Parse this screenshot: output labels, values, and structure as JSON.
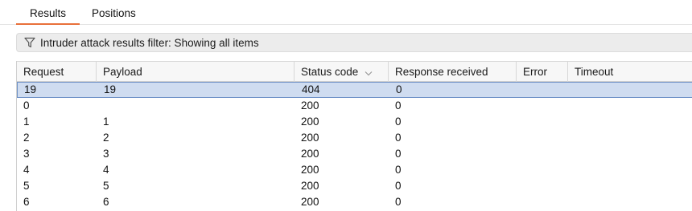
{
  "tabs": {
    "results": "Results",
    "positions": "Positions"
  },
  "filter": {
    "text": "Intruder attack results filter: Showing all items",
    "icon": "funnel-icon"
  },
  "table": {
    "columns": {
      "request": "Request",
      "payload": "Payload",
      "status": "Status code",
      "response": "Response received",
      "error": "Error",
      "timeout": "Timeout"
    },
    "sort_column": "status",
    "sort_direction": "descending",
    "selected_row": 0,
    "selection_color": "#cfdcf0",
    "rows": [
      {
        "request": "19",
        "payload": "19",
        "status": "404",
        "response": "0",
        "error": "",
        "timeout": ""
      },
      {
        "request": "0",
        "payload": "",
        "status": "200",
        "response": "0",
        "error": "",
        "timeout": ""
      },
      {
        "request": "1",
        "payload": "1",
        "status": "200",
        "response": "0",
        "error": "",
        "timeout": ""
      },
      {
        "request": "2",
        "payload": "2",
        "status": "200",
        "response": "0",
        "error": "",
        "timeout": ""
      },
      {
        "request": "3",
        "payload": "3",
        "status": "200",
        "response": "0",
        "error": "",
        "timeout": ""
      },
      {
        "request": "4",
        "payload": "4",
        "status": "200",
        "response": "0",
        "error": "",
        "timeout": ""
      },
      {
        "request": "5",
        "payload": "5",
        "status": "200",
        "response": "0",
        "error": "",
        "timeout": ""
      },
      {
        "request": "6",
        "payload": "6",
        "status": "200",
        "response": "0",
        "error": "",
        "timeout": ""
      }
    ]
  },
  "colors": {
    "accent": "#e8703a",
    "selection_border": "#6d90c6"
  }
}
